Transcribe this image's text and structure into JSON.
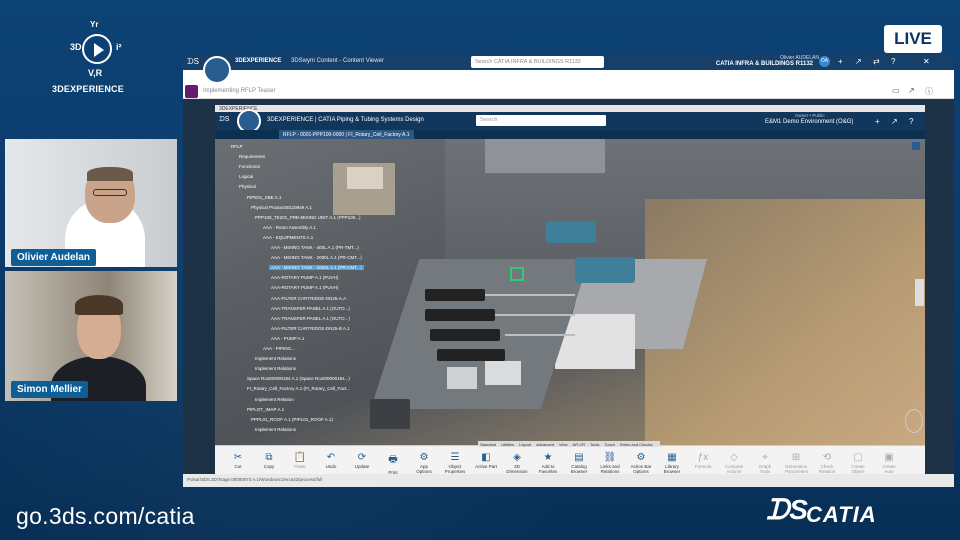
{
  "branding": {
    "logo_top": "Yr",
    "logo_left": "3D",
    "logo_right": "i²",
    "logo_bottom": "V,R",
    "logo_text": "3DEXPERIENCE",
    "url": "go.3ds.com/catia",
    "product": "CATIA",
    "live": "LIVE"
  },
  "speakers": [
    {
      "name": "Olivier Audelan"
    },
    {
      "name": "Simon Mellier"
    }
  ],
  "outer_app": {
    "brand": "3DEXPERIENCE",
    "separator": "|",
    "content_viewer": "3DSwym Content - Content Viewer",
    "search_placeholder": "Search CATIA INFRA & BUILDINGS R1132",
    "user": "Olivier AUDELAN",
    "unit": "CATIA INFRA & BUILDINGS R1132",
    "avatar": "OA",
    "subbar_label": "Implementing RFLP Teaser"
  },
  "inner_app": {
    "window_title": "3DEXPERIENCE",
    "title": "3DEXPERIENCE | CATIA Piping & Tubing Systems Design",
    "search_placeholder": "Search",
    "env_role": "Owner • Public",
    "environment": "E&M1 Demo Environment (O&G)",
    "tab": "RFLP - 0001-PPP100-0000 | FI_Rotary_Cell_Factory A.1"
  },
  "tree": [
    {
      "text": "RFLP",
      "indent": 0
    },
    {
      "text": "Requirement",
      "indent": 2
    },
    {
      "text": "Functional",
      "indent": 2
    },
    {
      "text": "Logical",
      "indent": 2
    },
    {
      "text": "Physical",
      "indent": 2
    },
    {
      "text": "PIPE01_XBE A.1",
      "indent": 4
    },
    {
      "text": "Physical Product00119949 A.1",
      "indent": 5
    },
    {
      "text": "PPP100_TE201_PRE-MIXING UNIT A.1 (PPP100...)",
      "indent": 6
    },
    {
      "text": "AAA - Room Assembly A.1",
      "indent": 8
    },
    {
      "text": "AAA - EQUIPMENTS A.1",
      "indent": 8
    },
    {
      "text": "AAA - MIXING TANK - 400L A.1 (PR-TMT...)",
      "indent": 10
    },
    {
      "text": "AAA - MIXING TANK - 2000L A.1 (PR-CMT...)",
      "indent": 10
    },
    {
      "text": "AAA - MIXING TANK - 2000L A.1 (PR-CMT...)",
      "indent": 10,
      "selected": true
    },
    {
      "text": "AAA-ROTARY PUMP A.1 (PUVH)",
      "indent": 10
    },
    {
      "text": "AAA-ROTARY PUMP A.1 (PUVH)",
      "indent": 10
    },
    {
      "text": "AAA-FILTER CARTRIDGE-DN25-A.A",
      "indent": 10
    },
    {
      "text": "AAA-TRANSFER PANEL A.1 (OUTO...)",
      "indent": 10
    },
    {
      "text": "AAA-TRANSFER PANEL A.1 (OUTO...)",
      "indent": 10
    },
    {
      "text": "AAA-FILTER CARTRIDGE-DN25-B A.1",
      "indent": 10
    },
    {
      "text": "AAA - PUMP A.1",
      "indent": 10
    },
    {
      "text": "AAA - PIPING...",
      "indent": 8
    },
    {
      "text": "Implement Relations",
      "indent": 6
    },
    {
      "text": "Implement Relations",
      "indent": 6
    },
    {
      "text": "Space Root00000184 A.1 (Space Root00000184...)",
      "indent": 4
    },
    {
      "text": "FI_Rotary_Cell_Factory A.1 (FI_Rotary_Cell_Fact...",
      "indent": 4
    },
    {
      "text": "Implement Relation",
      "indent": 6
    },
    {
      "text": "PIPLOT_IMAP A.1",
      "indent": 4
    },
    {
      "text": "PPPL01_ROOF A.1 (PIPL01_ROOF A.1)",
      "indent": 5
    },
    {
      "text": "Implement Relations",
      "indent": 6
    }
  ],
  "action_tabs": [
    "Standard",
    "Utilities",
    "Layout",
    "Advanced",
    "View",
    "AR-VR",
    "Tools",
    "Touch",
    "Rules and Checks"
  ],
  "tools": [
    {
      "label": "Cut",
      "icon": "✂",
      "enabled": true
    },
    {
      "label": "Copy",
      "icon": "⧉",
      "enabled": true
    },
    {
      "label": "Paste",
      "icon": "📋",
      "enabled": false
    },
    {
      "label": "Undo",
      "icon": "↶",
      "enabled": true
    },
    {
      "label": "Update",
      "icon": "⟳",
      "enabled": true
    },
    {
      "label": "Print Screen",
      "icon": "🖶",
      "enabled": true
    },
    {
      "label": "App Options",
      "icon": "⚙",
      "enabled": true
    },
    {
      "label": "Object Properties",
      "icon": "☰",
      "enabled": true
    },
    {
      "label": "Active Part",
      "icon": "◧",
      "enabled": true
    },
    {
      "label": "3D Dimension",
      "icon": "◈",
      "enabled": true
    },
    {
      "label": "Add to Favorites",
      "icon": "★",
      "enabled": true
    },
    {
      "label": "Catalog Browser",
      "icon": "▤",
      "enabled": true
    },
    {
      "label": "Links and Relations",
      "icon": "⛓",
      "enabled": true
    },
    {
      "label": "Action Bar Options",
      "icon": "⚙",
      "enabled": true
    },
    {
      "label": "Library Browser",
      "icon": "▦",
      "enabled": true
    },
    {
      "label": "Formula",
      "icon": "ƒx",
      "enabled": false
    },
    {
      "label": "Compute Volume",
      "icon": "◇",
      "enabled": false
    },
    {
      "label": "Graph Tools",
      "icon": "⌖",
      "enabled": false
    },
    {
      "label": "Generation Parameters",
      "icon": "⊞",
      "enabled": false
    },
    {
      "label": "Check Relation",
      "icon": "⟲",
      "enabled": false
    },
    {
      "label": "Create Object",
      "icon": "▢",
      "enabled": false
    },
    {
      "label": "Create Auto Object",
      "icon": "▣",
      "enabled": false
    }
  ],
  "status": "Pulsar/3DS.3D/Tsage:00000073 A.1/Wundows:Derca42/process/full"
}
